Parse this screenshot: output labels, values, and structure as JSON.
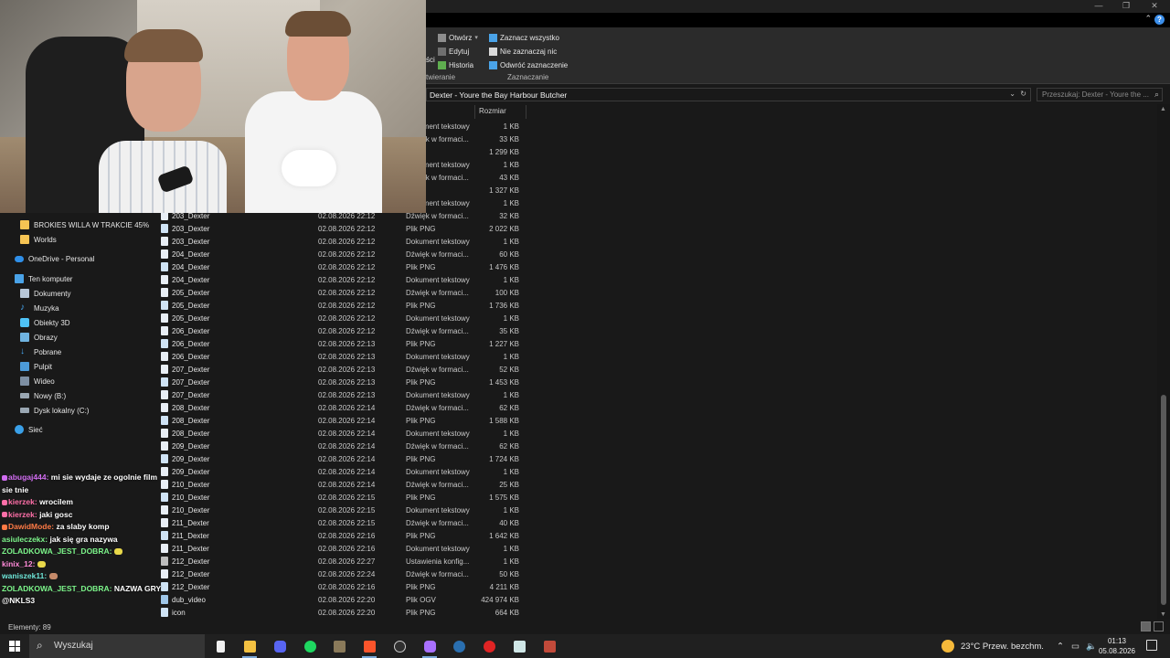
{
  "window": {
    "minimize": "—",
    "maximize": "❐",
    "close": "✕"
  },
  "ribbon": {
    "cut_label_fragment": "ści",
    "open_label": "Otwórz",
    "open_arrow": "▾",
    "edit_label": "Edytuj",
    "history_label": "Historia",
    "select_all_label": "Zaznacz wszystko",
    "select_none_label": "Nie zaznaczaj nic",
    "invert_selection_label": "Odwróć zaznaczenie",
    "group_open_fragment": "twieranie",
    "group_select": "Zaznaczanie"
  },
  "address": {
    "path": "Dexter - Youre the Bay Harbour Butcher",
    "search_placeholder": "Przeszukaj: Dexter - Youre the ..."
  },
  "columns": {
    "size": "Rozmiar"
  },
  "navigation": {
    "items": [
      {
        "label": "BROKIES WILLA W TRAKCIE 45%",
        "icon": "folder-icon"
      },
      {
        "label": "Worlds",
        "icon": "folder-icon"
      },
      {
        "label": "OneDrive - Personal",
        "icon": "cloud-icon"
      },
      {
        "label": "Ten komputer",
        "icon": "computer-icon"
      },
      {
        "label": "Dokumenty",
        "icon": "documents-icon"
      },
      {
        "label": "Muzyka",
        "icon": "music-icon"
      },
      {
        "label": "Obiekty 3D",
        "icon": "cube-icon"
      },
      {
        "label": "Obrazy",
        "icon": "pictures-icon"
      },
      {
        "label": "Pobrane",
        "icon": "download-icon"
      },
      {
        "label": "Pulpit",
        "icon": "desktop-icon"
      },
      {
        "label": "Wideo",
        "icon": "video-icon"
      },
      {
        "label": "Nowy (B:)",
        "icon": "drive-icon"
      },
      {
        "label": "Dysk lokalny (C:)",
        "icon": "drive-icon"
      },
      {
        "label": "Sieć",
        "icon": "network-icon"
      }
    ]
  },
  "partial_rows": [
    {
      "type": "Dokument tekstowy",
      "size": "1 KB"
    },
    {
      "type": "Dźwięk w formaci...",
      "size": "33 KB"
    },
    {
      "type": "PNG",
      "size": "1 299 KB"
    },
    {
      "type": "Dokument tekstowy",
      "size": "1 KB"
    },
    {
      "type": "Dźwięk w formaci...",
      "size": "43 KB"
    },
    {
      "type": "PNG",
      "size": "1 327 KB"
    },
    {
      "type": "Dokument tekstowy",
      "size": "1 KB"
    }
  ],
  "files": [
    {
      "name": "203_Dexter",
      "date": "02.08.2026 22:12",
      "type": "Dźwięk w formaci...",
      "size": "32 KB"
    },
    {
      "name": "203_Dexter",
      "date": "02.08.2026 22:12",
      "type": "Plik PNG",
      "size": "2 022 KB"
    },
    {
      "name": "203_Dexter",
      "date": "02.08.2026 22:12",
      "type": "Dokument tekstowy",
      "size": "1 KB"
    },
    {
      "name": "204_Dexter",
      "date": "02.08.2026 22:12",
      "type": "Dźwięk w formaci...",
      "size": "60 KB"
    },
    {
      "name": "204_Dexter",
      "date": "02.08.2026 22:12",
      "type": "Plik PNG",
      "size": "1 476 KB"
    },
    {
      "name": "204_Dexter",
      "date": "02.08.2026 22:12",
      "type": "Dokument tekstowy",
      "size": "1 KB"
    },
    {
      "name": "205_Dexter",
      "date": "02.08.2026 22:12",
      "type": "Dźwięk w formaci...",
      "size": "100 KB"
    },
    {
      "name": "205_Dexter",
      "date": "02.08.2026 22:12",
      "type": "Plik PNG",
      "size": "1 736 KB"
    },
    {
      "name": "205_Dexter",
      "date": "02.08.2026 22:12",
      "type": "Dokument tekstowy",
      "size": "1 KB"
    },
    {
      "name": "206_Dexter",
      "date": "02.08.2026 22:12",
      "type": "Dźwięk w formaci...",
      "size": "35 KB"
    },
    {
      "name": "206_Dexter",
      "date": "02.08.2026 22:13",
      "type": "Plik PNG",
      "size": "1 227 KB"
    },
    {
      "name": "206_Dexter",
      "date": "02.08.2026 22:13",
      "type": "Dokument tekstowy",
      "size": "1 KB"
    },
    {
      "name": "207_Dexter",
      "date": "02.08.2026 22:13",
      "type": "Dźwięk w formaci...",
      "size": "52 KB"
    },
    {
      "name": "207_Dexter",
      "date": "02.08.2026 22:13",
      "type": "Plik PNG",
      "size": "1 453 KB"
    },
    {
      "name": "207_Dexter",
      "date": "02.08.2026 22:13",
      "type": "Dokument tekstowy",
      "size": "1 KB"
    },
    {
      "name": "208_Dexter",
      "date": "02.08.2026 22:14",
      "type": "Dźwięk w formaci...",
      "size": "62 KB"
    },
    {
      "name": "208_Dexter",
      "date": "02.08.2026 22:14",
      "type": "Plik PNG",
      "size": "1 588 KB"
    },
    {
      "name": "208_Dexter",
      "date": "02.08.2026 22:14",
      "type": "Dokument tekstowy",
      "size": "1 KB"
    },
    {
      "name": "209_Dexter",
      "date": "02.08.2026 22:14",
      "type": "Dźwięk w formaci...",
      "size": "62 KB"
    },
    {
      "name": "209_Dexter",
      "date": "02.08.2026 22:14",
      "type": "Plik PNG",
      "size": "1 724 KB"
    },
    {
      "name": "209_Dexter",
      "date": "02.08.2026 22:14",
      "type": "Dokument tekstowy",
      "size": "1 KB"
    },
    {
      "name": "210_Dexter",
      "date": "02.08.2026 22:14",
      "type": "Dźwięk w formaci...",
      "size": "25 KB"
    },
    {
      "name": "210_Dexter",
      "date": "02.08.2026 22:15",
      "type": "Plik PNG",
      "size": "1 575 KB"
    },
    {
      "name": "210_Dexter",
      "date": "02.08.2026 22:15",
      "type": "Dokument tekstowy",
      "size": "1 KB"
    },
    {
      "name": "211_Dexter",
      "date": "02.08.2026 22:15",
      "type": "Dźwięk w formaci...",
      "size": "40 KB"
    },
    {
      "name": "211_Dexter",
      "date": "02.08.2026 22:16",
      "type": "Plik PNG",
      "size": "1 642 KB"
    },
    {
      "name": "211_Dexter",
      "date": "02.08.2026 22:16",
      "type": "Dokument tekstowy",
      "size": "1 KB"
    },
    {
      "name": "212_Dexter",
      "date": "02.08.2026 22:27",
      "type": "Ustawienia konfig...",
      "size": "1 KB"
    },
    {
      "name": "212_Dexter",
      "date": "02.08.2026 22:24",
      "type": "Dźwięk w formaci...",
      "size": "50 KB"
    },
    {
      "name": "212_Dexter",
      "date": "02.08.2026 22:16",
      "type": "Plik PNG",
      "size": "4 211 KB"
    },
    {
      "name": "dub_video",
      "date": "02.08.2026 22:20",
      "type": "Plik OGV",
      "size": "424 974 KB"
    },
    {
      "name": "icon",
      "date": "02.08.2026 22:20",
      "type": "Plik PNG",
      "size": "664 KB"
    }
  ],
  "status": {
    "count": "Elementy: 89"
  },
  "chat": [
    {
      "user": "abugaj444",
      "sep": ":",
      "msg": "mi sie wydaje ze ogolnie film",
      "color": "#d06cf0"
    },
    {
      "user": "",
      "sep": "",
      "msg": "sie tnie",
      "color": "#ffffff"
    },
    {
      "user": "kierzek",
      "sep": ":",
      "msg": "wrocilem",
      "color": "#ff6fa8"
    },
    {
      "user": "kierzek",
      "sep": ":",
      "msg": "jaki gosc",
      "color": "#ff6fa8"
    },
    {
      "user": "DawidMode",
      "sep": ":",
      "msg": "za slaby komp",
      "color": "#ff7a45"
    },
    {
      "user": "asiuleczekx",
      "sep": ":",
      "msg": "jak się gra nazywa",
      "color": "#7cf58a"
    },
    {
      "user": "ZOLADKOWA_JEST_DOBRA",
      "sep": ":",
      "msg": "",
      "color": "#7cf58a"
    },
    {
      "user": "kinix_12",
      "sep": ":",
      "msg": "",
      "color": "#ff8ad8"
    },
    {
      "user": "waniszek11",
      "sep": ":",
      "msg": "",
      "color": "#6ee6d8"
    },
    {
      "user": "ZOLADKOWA_JEST_DOBRA",
      "sep": ":",
      "msg": "NAZWA GRY",
      "color": "#7cf58a"
    },
    {
      "user": "",
      "sep": "",
      "msg": "@NKLS3",
      "color": "#ffffff"
    }
  ],
  "taskbar": {
    "search_label": "Wyszukaj",
    "weather": "23°C  Przew. bezchm.",
    "time": "01:13",
    "date": "05.08.2026"
  }
}
